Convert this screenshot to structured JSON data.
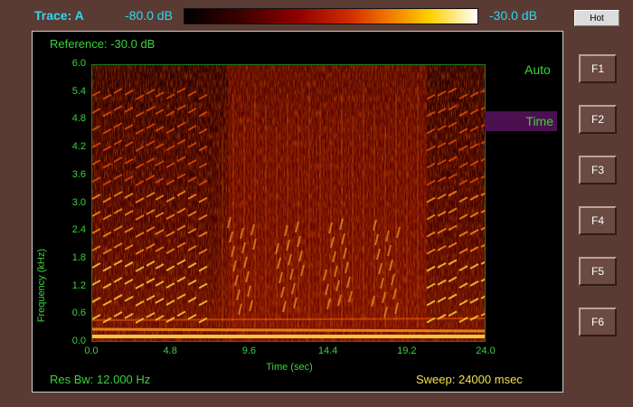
{
  "header": {
    "trace_label": "Trace: A",
    "db_min": "-80.0 dB",
    "db_max": "-30.0 dB",
    "palette_button": "Hot"
  },
  "plot": {
    "reference": "Reference:  -30.0 dB",
    "y_label": "Frequency (kHz)",
    "x_label": "Time (sec)",
    "y_ticks": [
      "6.0",
      "5.4",
      "4.8",
      "4.2",
      "3.6",
      "3.0",
      "2.4",
      "1.8",
      "1.2",
      "0.6",
      "0.0"
    ],
    "x_ticks": [
      "0.0",
      "4.8",
      "9.6",
      "14.4",
      "19.2",
      "24.0"
    ],
    "res_bw": "Res Bw:  12.000 Hz",
    "sweep": "Sweep:  24000 msec",
    "x_range": [
      0,
      24
    ],
    "y_range": [
      0,
      6
    ]
  },
  "side": {
    "auto_label": "Auto",
    "time_label": "Time"
  },
  "fkeys": [
    "F1",
    "F2",
    "F3",
    "F4",
    "F5",
    "F6"
  ],
  "colors": {
    "text_cyan": "#2ed8f0",
    "text_green": "#39d33c",
    "text_yellow": "#f2e14a",
    "frame": "#5a3b33",
    "highlight": "#4b1050"
  }
}
